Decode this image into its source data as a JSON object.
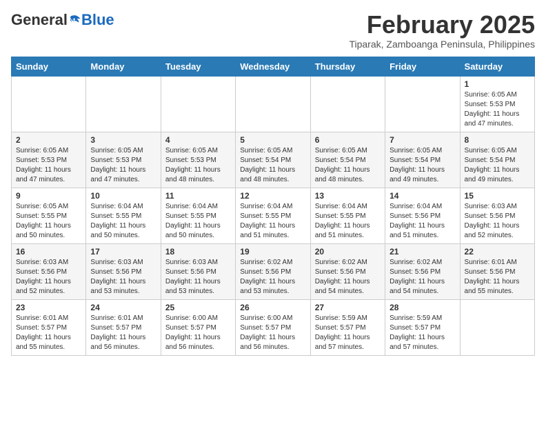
{
  "header": {
    "logo_general": "General",
    "logo_blue": "Blue",
    "month_title": "February 2025",
    "location": "Tiparak, Zamboanga Peninsula, Philippines"
  },
  "calendar": {
    "days_of_week": [
      "Sunday",
      "Monday",
      "Tuesday",
      "Wednesday",
      "Thursday",
      "Friday",
      "Saturday"
    ],
    "weeks": [
      [
        {
          "day": "",
          "info": ""
        },
        {
          "day": "",
          "info": ""
        },
        {
          "day": "",
          "info": ""
        },
        {
          "day": "",
          "info": ""
        },
        {
          "day": "",
          "info": ""
        },
        {
          "day": "",
          "info": ""
        },
        {
          "day": "1",
          "info": "Sunrise: 6:05 AM\nSunset: 5:53 PM\nDaylight: 11 hours\nand 47 minutes."
        }
      ],
      [
        {
          "day": "2",
          "info": "Sunrise: 6:05 AM\nSunset: 5:53 PM\nDaylight: 11 hours\nand 47 minutes."
        },
        {
          "day": "3",
          "info": "Sunrise: 6:05 AM\nSunset: 5:53 PM\nDaylight: 11 hours\nand 47 minutes."
        },
        {
          "day": "4",
          "info": "Sunrise: 6:05 AM\nSunset: 5:53 PM\nDaylight: 11 hours\nand 48 minutes."
        },
        {
          "day": "5",
          "info": "Sunrise: 6:05 AM\nSunset: 5:54 PM\nDaylight: 11 hours\nand 48 minutes."
        },
        {
          "day": "6",
          "info": "Sunrise: 6:05 AM\nSunset: 5:54 PM\nDaylight: 11 hours\nand 48 minutes."
        },
        {
          "day": "7",
          "info": "Sunrise: 6:05 AM\nSunset: 5:54 PM\nDaylight: 11 hours\nand 49 minutes."
        },
        {
          "day": "8",
          "info": "Sunrise: 6:05 AM\nSunset: 5:54 PM\nDaylight: 11 hours\nand 49 minutes."
        }
      ],
      [
        {
          "day": "9",
          "info": "Sunrise: 6:05 AM\nSunset: 5:55 PM\nDaylight: 11 hours\nand 50 minutes."
        },
        {
          "day": "10",
          "info": "Sunrise: 6:04 AM\nSunset: 5:55 PM\nDaylight: 11 hours\nand 50 minutes."
        },
        {
          "day": "11",
          "info": "Sunrise: 6:04 AM\nSunset: 5:55 PM\nDaylight: 11 hours\nand 50 minutes."
        },
        {
          "day": "12",
          "info": "Sunrise: 6:04 AM\nSunset: 5:55 PM\nDaylight: 11 hours\nand 51 minutes."
        },
        {
          "day": "13",
          "info": "Sunrise: 6:04 AM\nSunset: 5:55 PM\nDaylight: 11 hours\nand 51 minutes."
        },
        {
          "day": "14",
          "info": "Sunrise: 6:04 AM\nSunset: 5:56 PM\nDaylight: 11 hours\nand 51 minutes."
        },
        {
          "day": "15",
          "info": "Sunrise: 6:03 AM\nSunset: 5:56 PM\nDaylight: 11 hours\nand 52 minutes."
        }
      ],
      [
        {
          "day": "16",
          "info": "Sunrise: 6:03 AM\nSunset: 5:56 PM\nDaylight: 11 hours\nand 52 minutes."
        },
        {
          "day": "17",
          "info": "Sunrise: 6:03 AM\nSunset: 5:56 PM\nDaylight: 11 hours\nand 53 minutes."
        },
        {
          "day": "18",
          "info": "Sunrise: 6:03 AM\nSunset: 5:56 PM\nDaylight: 11 hours\nand 53 minutes."
        },
        {
          "day": "19",
          "info": "Sunrise: 6:02 AM\nSunset: 5:56 PM\nDaylight: 11 hours\nand 53 minutes."
        },
        {
          "day": "20",
          "info": "Sunrise: 6:02 AM\nSunset: 5:56 PM\nDaylight: 11 hours\nand 54 minutes."
        },
        {
          "day": "21",
          "info": "Sunrise: 6:02 AM\nSunset: 5:56 PM\nDaylight: 11 hours\nand 54 minutes."
        },
        {
          "day": "22",
          "info": "Sunrise: 6:01 AM\nSunset: 5:56 PM\nDaylight: 11 hours\nand 55 minutes."
        }
      ],
      [
        {
          "day": "23",
          "info": "Sunrise: 6:01 AM\nSunset: 5:57 PM\nDaylight: 11 hours\nand 55 minutes."
        },
        {
          "day": "24",
          "info": "Sunrise: 6:01 AM\nSunset: 5:57 PM\nDaylight: 11 hours\nand 56 minutes."
        },
        {
          "day": "25",
          "info": "Sunrise: 6:00 AM\nSunset: 5:57 PM\nDaylight: 11 hours\nand 56 minutes."
        },
        {
          "day": "26",
          "info": "Sunrise: 6:00 AM\nSunset: 5:57 PM\nDaylight: 11 hours\nand 56 minutes."
        },
        {
          "day": "27",
          "info": "Sunrise: 5:59 AM\nSunset: 5:57 PM\nDaylight: 11 hours\nand 57 minutes."
        },
        {
          "day": "28",
          "info": "Sunrise: 5:59 AM\nSunset: 5:57 PM\nDaylight: 11 hours\nand 57 minutes."
        },
        {
          "day": "",
          "info": ""
        }
      ]
    ]
  }
}
